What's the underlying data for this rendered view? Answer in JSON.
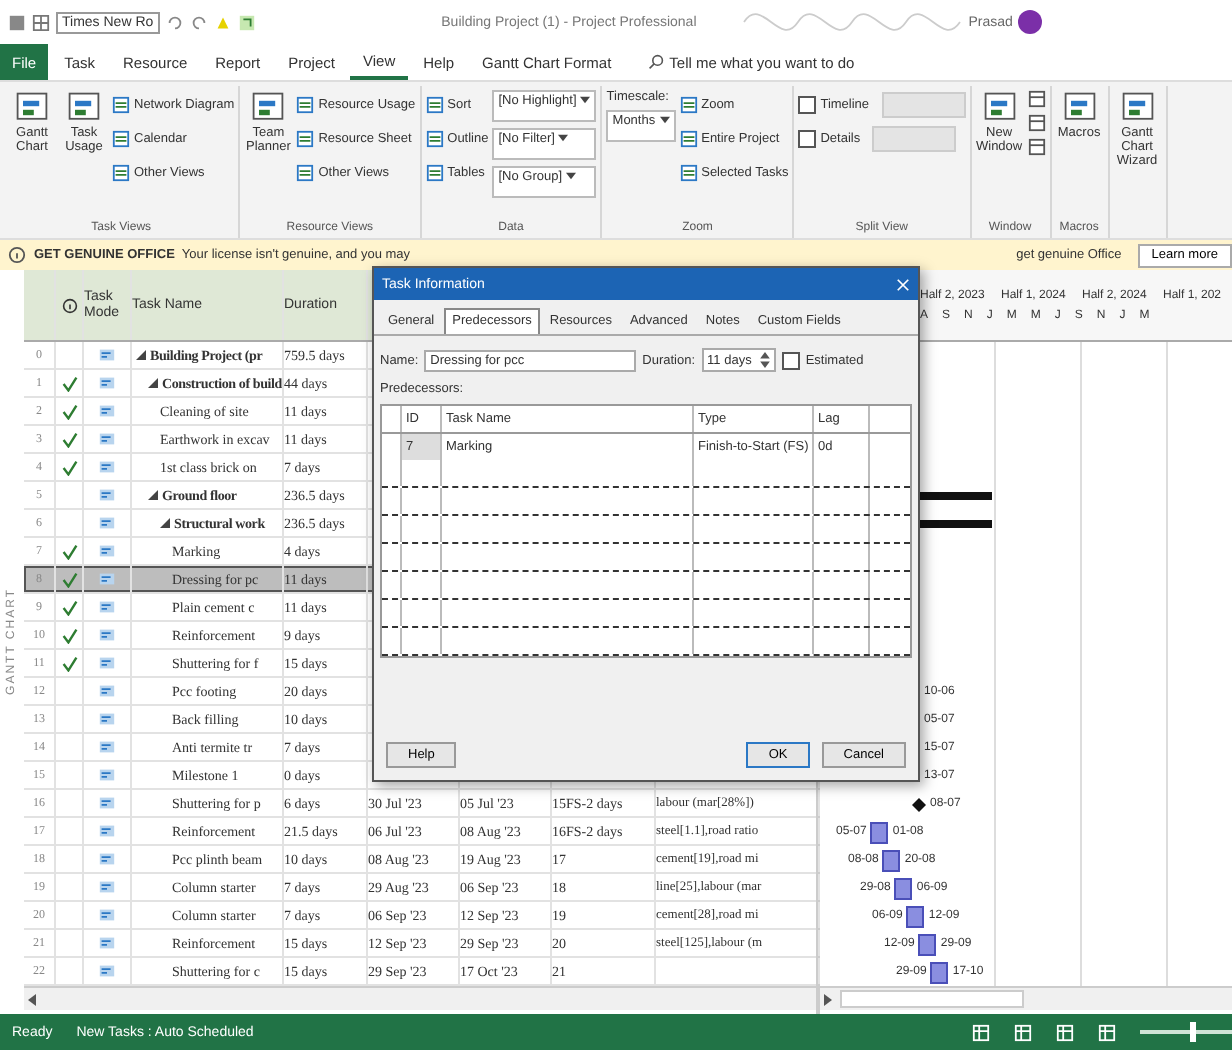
{
  "title_bar": {
    "font_box": "Times New Ro",
    "title": "Building Project (1) - Project Professional",
    "user": "Prasad"
  },
  "ribbon_tabs": [
    {
      "label": "File",
      "kind": "file",
      "selected": false
    },
    {
      "label": "Task",
      "kind": "tab",
      "selected": false
    },
    {
      "label": "Resource",
      "kind": "tab",
      "selected": false
    },
    {
      "label": "Report",
      "kind": "tab",
      "selected": false
    },
    {
      "label": "Project",
      "kind": "tab",
      "selected": false
    },
    {
      "label": "View",
      "kind": "tab",
      "selected": true
    },
    {
      "label": "Help",
      "kind": "tab",
      "selected": false
    },
    {
      "label": "Gantt Chart Format",
      "kind": "tab",
      "selected": false
    }
  ],
  "tell_me": "Tell me what you want to do",
  "ribbon_groups": [
    {
      "label": "Task Views",
      "columns": [
        [
          {
            "kind": "large",
            "label": "Gantt Chart"
          }
        ],
        [
          {
            "kind": "large",
            "label": "Task Usage"
          }
        ],
        [
          {
            "kind": "small",
            "label": "Network Diagram"
          },
          {
            "kind": "small",
            "label": "Calendar"
          },
          {
            "kind": "small",
            "label": "Other Views"
          }
        ]
      ]
    },
    {
      "label": "Resource Views",
      "columns": [
        [
          {
            "kind": "large",
            "label": "Team Planner"
          }
        ],
        [
          {
            "kind": "small",
            "label": "Resource Usage"
          },
          {
            "kind": "small",
            "label": "Resource Sheet"
          },
          {
            "kind": "small",
            "label": "Other Views"
          }
        ]
      ]
    },
    {
      "label": "Data",
      "columns": [
        [
          {
            "kind": "small",
            "label": "Sort"
          },
          {
            "kind": "small",
            "label": "Outline"
          },
          {
            "kind": "small",
            "label": "Tables"
          }
        ],
        [
          {
            "kind": "dropdown",
            "label": "[No Highlight]"
          },
          {
            "kind": "dropdown",
            "label": "[No Filter]"
          },
          {
            "kind": "dropdown",
            "label": "[No Group]"
          }
        ]
      ]
    },
    {
      "label": "Zoom",
      "columns": [
        [
          {
            "kind": "text",
            "label": "Timescale:"
          },
          {
            "kind": "dropdown",
            "label": "Months"
          }
        ],
        [
          {
            "kind": "small",
            "label": "Zoom"
          },
          {
            "kind": "small",
            "label": "Entire Project"
          },
          {
            "kind": "small",
            "label": "Selected Tasks"
          }
        ]
      ]
    },
    {
      "label": "Split View",
      "columns": [
        [
          {
            "kind": "check",
            "label": "Timeline",
            "checked": false
          },
          {
            "kind": "check",
            "label": "Details",
            "checked": false
          }
        ]
      ]
    },
    {
      "label": "Window",
      "columns": [
        [
          {
            "kind": "large",
            "label": "New Window"
          }
        ],
        [
          {
            "kind": "icon"
          },
          {
            "kind": "icon"
          },
          {
            "kind": "icon"
          }
        ]
      ]
    },
    {
      "label": "Macros",
      "columns": [
        [
          {
            "kind": "large",
            "label": "Macros"
          }
        ]
      ]
    },
    {
      "columns": [
        [
          {
            "kind": "large",
            "label": "Gantt Chart Wizard"
          }
        ]
      ]
    }
  ],
  "message_bar": {
    "title": "GET GENUINE OFFICE",
    "text": "Your license isn't genuine, and you may",
    "text_end": "get genuine Office",
    "button": "Learn more"
  },
  "side_label": "GANTT CHART",
  "table": {
    "columns": {
      "mode": "Task Mode",
      "name": "Task Name",
      "duration": "Duration"
    },
    "rows": [
      {
        "id": "0",
        "done": false,
        "selected": false,
        "name": "Building Project (pr",
        "duration": "759.5 days",
        "children": [
          {
            "id": "1",
            "done": true,
            "selected": false,
            "name": "Construction of build",
            "duration": "44 days",
            "children": [
              {
                "id": "2",
                "done": true,
                "selected": false,
                "name": "Cleaning of site",
                "duration": "11 days"
              },
              {
                "id": "3",
                "done": true,
                "selected": false,
                "name": "Earthwork in excav",
                "duration": "11 days"
              },
              {
                "id": "4",
                "done": true,
                "selected": false,
                "name": "1st class brick on",
                "duration": "7 days"
              }
            ]
          },
          {
            "id": "5",
            "done": false,
            "selected": false,
            "name": "Ground floor",
            "duration": "236.5 days",
            "gantt": {
              "kind": "summary"
            },
            "children": [
              {
                "id": "6",
                "done": false,
                "selected": false,
                "name": "Structural work",
                "duration": "236.5 days",
                "gantt": {
                  "kind": "summary"
                },
                "children": [
                  {
                    "id": "7",
                    "done": true,
                    "selected": false,
                    "name": "Marking",
                    "duration": "4 days"
                  },
                  {
                    "id": "8",
                    "done": true,
                    "selected": true,
                    "name": "Dressing for pc",
                    "duration": "11 days"
                  },
                  {
                    "id": "9",
                    "done": true,
                    "selected": false,
                    "name": "Plain cement c",
                    "duration": "11 days"
                  },
                  {
                    "id": "10",
                    "done": true,
                    "selected": false,
                    "name": "Reinforcement",
                    "duration": "9 days"
                  },
                  {
                    "id": "11",
                    "done": true,
                    "selected": false,
                    "name": "Shuttering for f",
                    "duration": "15 days"
                  },
                  {
                    "id": "12",
                    "done": false,
                    "selected": false,
                    "name": "Pcc footing",
                    "duration": "20 days",
                    "gantt": {
                      "kind": "label",
                      "end_label": "10-06"
                    }
                  },
                  {
                    "id": "13",
                    "done": false,
                    "selected": false,
                    "name": "Back filling",
                    "duration": "10 days",
                    "gantt": {
                      "kind": "label",
                      "end_label": "05-07"
                    }
                  },
                  {
                    "id": "14",
                    "done": false,
                    "selected": false,
                    "name": "Anti termite tr",
                    "duration": "7 days",
                    "gantt": {
                      "kind": "label",
                      "end_label": "15-07"
                    }
                  },
                  {
                    "id": "15",
                    "done": false,
                    "selected": false,
                    "name": "Milestone 1",
                    "duration": "0 days",
                    "gantt": {
                      "kind": "label",
                      "end_label": "13-07"
                    }
                  },
                  {
                    "id": "16",
                    "done": false,
                    "selected": false,
                    "name": "Shuttering for p",
                    "duration": "6 days",
                    "start": "30 Jul '23",
                    "finish": "05 Jul '23",
                    "predecessors": "15FS-2 days",
                    "resources": "labour (mar[28%])",
                    "gantt": {
                      "kind": "milestone",
                      "end_label": "08-07"
                    }
                  },
                  {
                    "id": "17",
                    "done": false,
                    "selected": false,
                    "name": "Reinforcement",
                    "duration": "21.5 days",
                    "start": "06 Jul '23",
                    "finish": "08 Aug '23",
                    "predecessors": "16FS-2 days",
                    "resources": "steel[1.1],road ratio",
                    "gantt": {
                      "kind": "bar",
                      "start_label": "05-07",
                      "end_label": "01-08"
                    }
                  },
                  {
                    "id": "18",
                    "done": false,
                    "selected": false,
                    "name": "Pcc plinth beam",
                    "duration": "10 days",
                    "start": "08 Aug '23",
                    "finish": "19 Aug '23",
                    "predecessors": "17",
                    "resources": "cement[19],road mi",
                    "gantt": {
                      "kind": "bar",
                      "start_label": "08-08",
                      "end_label": "20-08"
                    }
                  },
                  {
                    "id": "19",
                    "done": false,
                    "selected": false,
                    "name": "Column starter",
                    "duration": "7 days",
                    "start": "29 Aug '23",
                    "finish": "06 Sep '23",
                    "predecessors": "18",
                    "resources": "line[25],labour (mar",
                    "gantt": {
                      "kind": "bar",
                      "start_label": "29-08",
                      "end_label": "06-09"
                    }
                  },
                  {
                    "id": "20",
                    "done": false,
                    "selected": false,
                    "name": "Column starter",
                    "duration": "7 days",
                    "start": "06 Sep '23",
                    "finish": "12 Sep '23",
                    "predecessors": "19",
                    "resources": "cement[28],road mi",
                    "gantt": {
                      "kind": "bar",
                      "start_label": "06-09",
                      "end_label": "12-09"
                    }
                  },
                  {
                    "id": "21",
                    "done": false,
                    "selected": false,
                    "name": "Reinforcement",
                    "duration": "15 days",
                    "start": "12 Sep '23",
                    "finish": "29 Sep '23",
                    "predecessors": "20",
                    "resources": "steel[125],labour (m",
                    "gantt": {
                      "kind": "bar",
                      "start_label": "12-09",
                      "end_label": "29-09"
                    }
                  },
                  {
                    "id": "22",
                    "done": false,
                    "selected": false,
                    "name": "Shuttering for c",
                    "duration": "15 days",
                    "start": "29 Sep '23",
                    "finish": "17 Oct '23",
                    "predecessors": "21",
                    "gantt": {
                      "kind": "bar",
                      "start_label": "29-09",
                      "end_label": "17-10"
                    }
                  }
                ]
              }
            ]
          }
        ]
      }
    ]
  },
  "gantt_header": {
    "periods": [
      "Half 2, 2023",
      "Half 1, 2024",
      "Half 2, 2024",
      "Half 1, 202"
    ],
    "months": [
      "A",
      "S",
      "N",
      "J",
      "M",
      "M",
      "J",
      "S",
      "N",
      "J",
      "M"
    ]
  },
  "dialog": {
    "title": "Task Information",
    "tabs": [
      {
        "label": "General",
        "selected": false
      },
      {
        "label": "Predecessors",
        "selected": true
      },
      {
        "label": "Resources",
        "selected": false
      },
      {
        "label": "Advanced",
        "selected": false
      },
      {
        "label": "Notes",
        "selected": false
      },
      {
        "label": "Custom Fields",
        "selected": false
      }
    ],
    "name_label": "Name:",
    "name": "Dressing for pcc",
    "duration_label": "Duration:",
    "duration": "11 days",
    "estimated": {
      "label": "Estimated",
      "checked": false
    },
    "section": "Predecessors:",
    "columns": [
      "ID",
      "Task Name",
      "Type",
      "Lag"
    ],
    "rows": [
      [
        "7",
        "Marking",
        "Finish-to-Start (FS)",
        "0d"
      ]
    ],
    "buttons": {
      "help": "Help",
      "ok": "OK",
      "cancel": "Cancel"
    }
  },
  "status_bar": {
    "mode": "Ready",
    "scheduling": "New Tasks : Auto Scheduled",
    "zoom": {
      "level": 0.5
    }
  }
}
